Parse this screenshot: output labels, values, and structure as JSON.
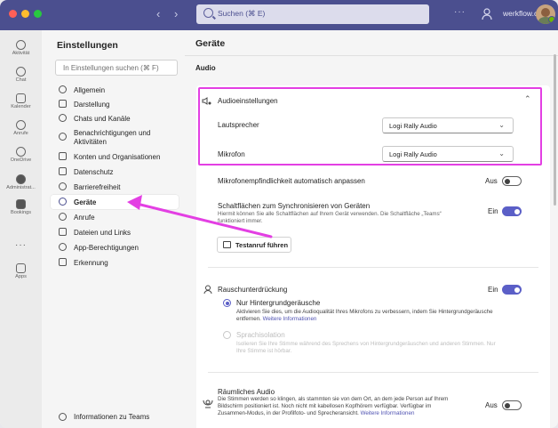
{
  "topbar": {
    "search_placeholder": "Suchen (⌘ E)",
    "org_name": "werkflow.ch",
    "more_label": "···",
    "nav_back": "‹",
    "nav_forward": "›"
  },
  "rail": {
    "items": [
      {
        "label": "Aktivität",
        "icon": "bell-icon"
      },
      {
        "label": "Chat",
        "icon": "chat-icon"
      },
      {
        "label": "Kalender",
        "icon": "calendar-icon"
      },
      {
        "label": "Anrufe",
        "icon": "phone-icon"
      },
      {
        "label": "OneDrive",
        "icon": "cloud-icon"
      },
      {
        "label": "Administrat...",
        "icon": "admin-icon"
      },
      {
        "label": "Bookings",
        "icon": "bookings-icon"
      },
      {
        "label": "Apps",
        "icon": "apps-icon"
      }
    ],
    "more": "···"
  },
  "settings": {
    "title": "Einstellungen",
    "search_placeholder": "In Einstellungen suchen (⌘ F)",
    "menu": [
      {
        "label": "Allgemein",
        "icon": "gear-icon"
      },
      {
        "label": "Darstellung",
        "icon": "wand-icon"
      },
      {
        "label": "Chats und Kanäle",
        "icon": "chat-icon"
      },
      {
        "label": "Benachrichtigungen und Aktivitäten",
        "icon": "bell-icon"
      },
      {
        "label": "Konten und Organisationen",
        "icon": "id-card-icon"
      },
      {
        "label": "Datenschutz",
        "icon": "lock-icon"
      },
      {
        "label": "Barrierefreiheit",
        "icon": "accessibility-icon"
      },
      {
        "label": "Geräte",
        "icon": "headset-icon"
      },
      {
        "label": "Anrufe",
        "icon": "phone-icon"
      },
      {
        "label": "Dateien und Links",
        "icon": "file-icon"
      },
      {
        "label": "App-Berechtigungen",
        "icon": "shield-icon"
      },
      {
        "label": "Erkennung",
        "icon": "keyboard-icon"
      }
    ],
    "info": "Informationen zu Teams"
  },
  "main": {
    "title": "Geräte",
    "section_audio": "Audio",
    "audio_settings": {
      "title": "Audioeinstellungen",
      "speaker_label": "Lautsprecher",
      "speaker_value": "Logi Rally Audio",
      "mic_label": "Mikrofon",
      "mic_value": "Logi Rally Audio"
    },
    "mic_sensitivity": {
      "label": "Mikrofonempfindlichkeit automatisch anpassen",
      "state": "Aus"
    },
    "sync_buttons": {
      "title": "Schaltflächen zum Synchronisieren von Geräten",
      "desc1": "Hiermit können Sie alle Schaltflächen auf Ihrem Gerät verwenden. Die Schaltfläche „Teams“",
      "desc2": "funktioniert immer.",
      "state": "Ein"
    },
    "test_call": "Testanruf führen",
    "noise": {
      "title": "Rauschunterdrückung",
      "state": "Ein",
      "opt1_title": "Nur Hintergrundgeräusche",
      "opt1_desc1": "Aktivieren Sie dies, um die Audioqualität Ihres Mikrofons zu verbessern, indem Sie Hintergrundgeräusche",
      "opt1_desc2": "entfernen.",
      "opt1_link": "Weitere Informationen",
      "opt2_title": "Sprachisolation",
      "opt2_desc1": "Isolieren Sie Ihre Stimme während des Sprechens von Hintergrundgeräuschen und anderen Stimmen. Nur",
      "opt2_desc2": "Ihre Stimme ist hörbar."
    },
    "spatial": {
      "title": "Räumliches Audio",
      "desc1": "Die Stimmen werden so klingen, als stammten sie von dem Ort, an dem jede Person auf Ihrem",
      "desc2": "Bildschirm positioniert ist. Noch nicht mit kabellosen Kopfhörern verfügbar. Verfügbar im",
      "desc3": "Zusammen-Modus, in der Profilfoto- und Sprecheransicht.",
      "link": "Weitere Informationen",
      "state": "Aus"
    }
  },
  "colors": {
    "brand": "#4b4f8f",
    "accent": "#5b5fc7",
    "highlight": "#e33fe3"
  }
}
